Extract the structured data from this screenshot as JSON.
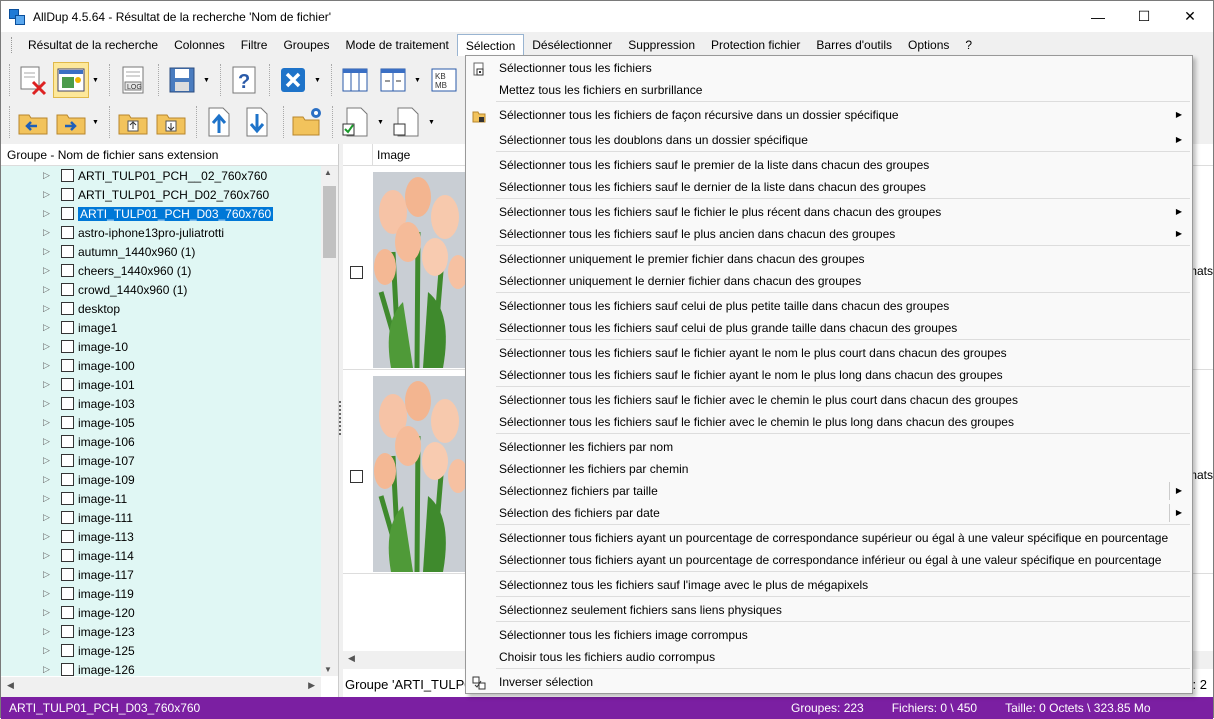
{
  "window": {
    "title": "AllDup 4.5.64 - Résultat de la recherche 'Nom de fichier'",
    "minimize": "—",
    "maximize": "☐",
    "close": "✕"
  },
  "menubar": [
    "Résultat de la recherche",
    "Colonnes",
    "Filtre",
    "Groupes",
    "Mode de traitement",
    "Sélection",
    "Désélectionner",
    "Suppression",
    "Protection fichier",
    "Barres d'outils",
    "Options",
    "?"
  ],
  "left_panel": {
    "header": "Groupe - Nom de fichier sans extension",
    "items": [
      "ARTI_TULP01_PCH__02_760x760",
      "ARTI_TULP01_PCH_D02_760x760",
      "ARTI_TULP01_PCH_D03_760x760",
      "astro-iphone13pro-juliatrotti",
      "autumn_1440x960 (1)",
      "cheers_1440x960 (1)",
      "crowd_1440x960 (1)",
      "desktop",
      "image1",
      "image-10",
      "image-100",
      "image-101",
      "image-103",
      "image-105",
      "image-106",
      "image-107",
      "image-109",
      "image-11",
      "image-111",
      "image-113",
      "image-114",
      "image-117",
      "image-119",
      "image-120",
      "image-123",
      "image-125",
      "image-126"
    ],
    "selected_index": 2
  },
  "right_panel": {
    "column_image": "Image",
    "row_right_text": "mats",
    "status_group": "Groupe 'ARTI_TULP0",
    "status_right": "s: 2"
  },
  "toolbar": {
    "log_label": "LOG",
    "kbmb_label": "KB MB"
  },
  "selection_menu": [
    {
      "label": "Sélectionner tous les fichiers",
      "icon": "select-all-icon"
    },
    {
      "label": "Mettez tous les fichiers en surbrillance"
    },
    {
      "label": "Sélectionner tous les fichiers de façon récursive dans un dossier spécifique",
      "submenu": true,
      "icon": "folder-icon"
    },
    {
      "label": "Sélectionner tous les doublons dans un dossier spécifique",
      "submenu": true
    },
    {
      "label": "Sélectionner tous les fichiers sauf le premier de la liste dans chacun des groupes"
    },
    {
      "label": "Sélectionner tous les fichiers sauf le dernier de la liste dans chacun des groupes"
    },
    {
      "label": "Sélectionner tous les fichiers sauf le fichier le plus récent dans chacun des groupes",
      "submenu": true
    },
    {
      "label": "Sélectionner tous les fichiers sauf le plus ancien dans chacun des groupes",
      "submenu": true
    },
    {
      "label": "Sélectionner uniquement le premier fichier dans chacun des groupes"
    },
    {
      "label": "Sélectionner uniquement le dernier fichier dans chacun des groupes"
    },
    {
      "label": "Sélectionner tous les fichiers sauf celui de plus petite taille dans chacun des groupes"
    },
    {
      "label": "Sélectionner tous les fichiers sauf celui de plus grande taille dans chacun des groupes"
    },
    {
      "label": "Sélectionner tous les fichiers sauf le fichier ayant le nom le plus court dans chacun des groupes"
    },
    {
      "label": "Sélectionner tous les fichiers sauf le fichier ayant le nom le plus long dans chacun des groupes"
    },
    {
      "label": "Sélectionner tous les fichiers sauf le fichier avec le chemin le plus court dans chacun des groupes"
    },
    {
      "label": "Sélectionner tous les fichiers sauf le fichier avec le chemin le plus long dans chacun des groupes"
    },
    {
      "label": "Sélectionner les fichiers par nom"
    },
    {
      "label": "Sélectionner les fichiers par chemin"
    },
    {
      "label": "Sélectionnez fichiers par taille",
      "submenu": true
    },
    {
      "label": "Sélection des fichiers par date",
      "submenu": true
    },
    {
      "label": "Sélectionner tous fichiers ayant un pourcentage de correspondance supérieur ou égal à une valeur spécifique en pourcentage"
    },
    {
      "label": "Sélectionner tous fichiers ayant un pourcentage de correspondance inférieur ou égal à une valeur spécifique en pourcentage"
    },
    {
      "label": "Sélectionnez tous les fichiers sauf l'image avec le plus de mégapixels"
    },
    {
      "label": "Sélectionnez seulement fichiers sans liens physiques"
    },
    {
      "label": "Sélectionner tous les fichiers image corrompus"
    },
    {
      "label": "Choisir tous les fichiers audio corrompus"
    },
    {
      "label": "Inverser sélection",
      "icon": "invert-selection-icon"
    }
  ],
  "statusbar": {
    "current": "ARTI_TULP01_PCH_D03_760x760",
    "groups": "Groupes: 223",
    "files": "Fichiers: 0 \\ 450",
    "size": "Taille: 0 Octets \\ 323.85 Mo"
  },
  "colors": {
    "tree_bg": "#e0f7f4",
    "selection": "#0078d7",
    "statusbar": "#7b1fa2",
    "toolbar_pressed": "#fde89a"
  }
}
